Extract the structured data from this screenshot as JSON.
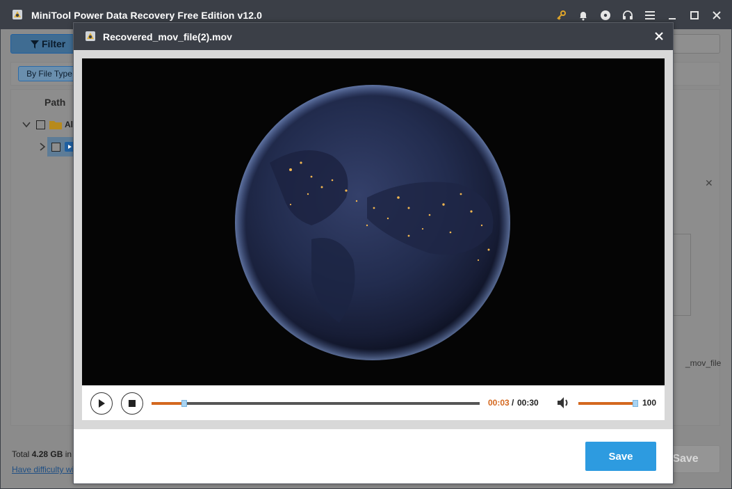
{
  "app": {
    "title": "MiniTool Power Data Recovery Free Edition v12.0",
    "icons": [
      "app-logo-icon",
      "key-icon",
      "bell-icon",
      "disc-icon",
      "headset-icon",
      "menu-icon",
      "minimize-icon",
      "maximize-icon",
      "close-icon"
    ]
  },
  "background": {
    "filter_label": "Filter",
    "by_file_type_label": "By File Type",
    "path_header": "Path",
    "tree_root_label": "All",
    "preview_file_label": "_mov_file",
    "total_prefix": "Total ",
    "total_size": "4.28 GB",
    "total_suffix": " in",
    "difficulty_link": "Have difficulty wi",
    "save_label": "Save"
  },
  "dialog": {
    "title": "Recovered_mov_file(2).mov",
    "player": {
      "time_current": "00:03",
      "time_separator": "/",
      "time_total": "00:30",
      "progress_fraction": 0.1,
      "volume": "100",
      "volume_fraction": 1.0
    },
    "save_label": "Save"
  },
  "colors": {
    "titlebar": "#3b3f47",
    "accent_orange": "#d4681f",
    "save_blue": "#2d9be0",
    "thumb_blue": "#a9d3f1"
  }
}
